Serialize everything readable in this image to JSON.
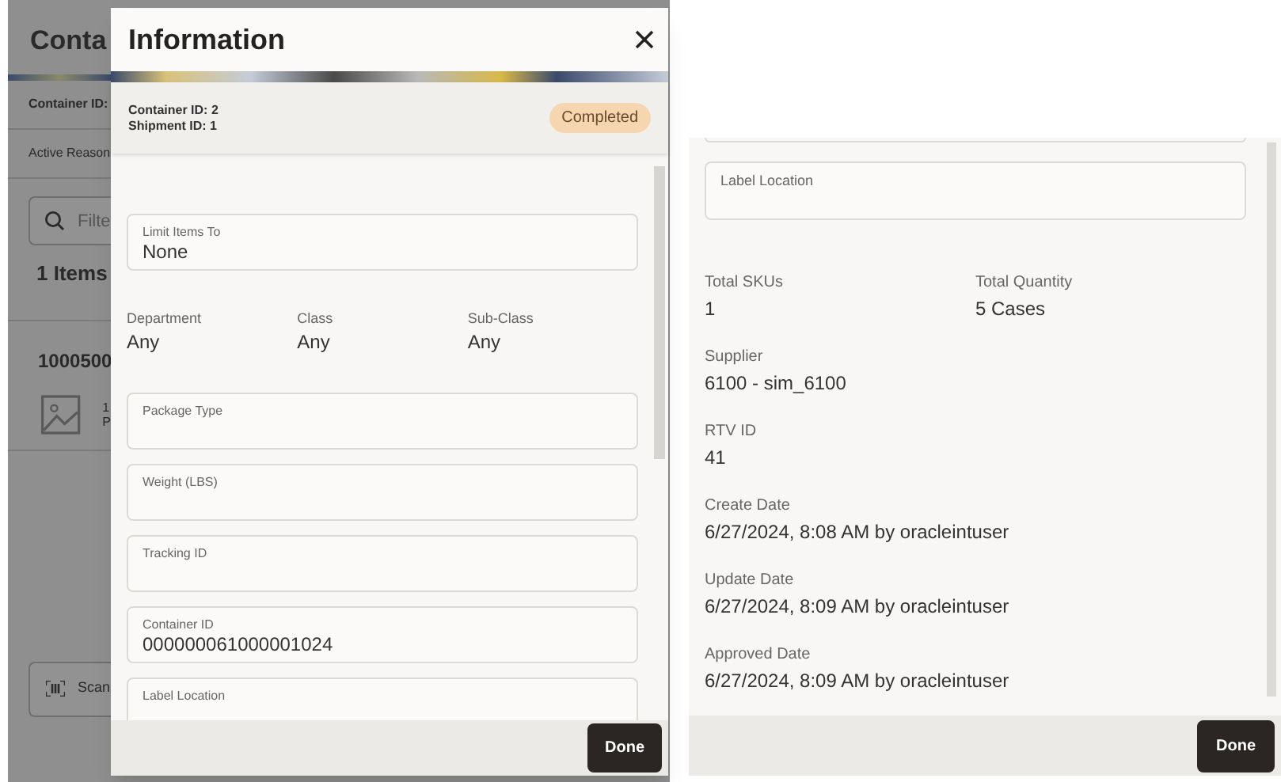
{
  "background_app": {
    "title": "Conta",
    "container_label": "Container ID:",
    "reason_label": "Active Reason",
    "search": {
      "placeholder": "Filte"
    },
    "items_count": "1 Items",
    "item_id": "1000500",
    "item_details": [
      "1",
      "P"
    ],
    "scan_button": "Scan"
  },
  "dialog": {
    "title": "Information",
    "summary": {
      "lines": [
        "Container ID: 2",
        "Shipment ID: 1"
      ],
      "status": "Completed"
    },
    "form": [
      {
        "kind": "field",
        "label": "Limit Items To",
        "value": "None"
      },
      {
        "kind": "info_row",
        "items": [
          {
            "label": "Department",
            "value": "Any"
          },
          {
            "label": "Class",
            "value": "Any"
          },
          {
            "label": "Sub-Class",
            "value": "Any"
          }
        ]
      },
      {
        "kind": "field",
        "label": "Package Type"
      },
      {
        "kind": "field",
        "label": "Weight (LBS)"
      },
      {
        "kind": "field",
        "label": "Tracking ID"
      },
      {
        "kind": "field",
        "label": "Container ID",
        "value": "000000061000001024"
      },
      {
        "kind": "field",
        "label": "Label Location"
      }
    ],
    "done_button": "Done"
  },
  "scrolled_dialog": {
    "form": [
      {
        "kind": "field_edge"
      },
      {
        "kind": "field",
        "label": "Label Location"
      },
      {
        "kind": "info_row",
        "items": [
          {
            "label": "Total SKUs",
            "value": "1"
          },
          {
            "label": "Total Quantity",
            "value": "5 Cases"
          }
        ]
      },
      {
        "kind": "info_row",
        "items": [
          {
            "label": "Supplier",
            "value": "6100 - sim_6100"
          }
        ]
      },
      {
        "kind": "info_row",
        "items": [
          {
            "label": "RTV ID",
            "value": "41"
          }
        ]
      },
      {
        "kind": "info_row",
        "items": [
          {
            "label": "Create Date",
            "value": "6/27/2024, 8:08 AM by oracleintuser"
          }
        ]
      },
      {
        "kind": "info_row",
        "items": [
          {
            "label": "Update Date",
            "value": "6/27/2024, 8:09 AM by oracleintuser"
          }
        ]
      },
      {
        "kind": "info_row",
        "items": [
          {
            "label": "Approved Date",
            "value": "6/27/2024, 8:09 AM by oracleintuser"
          }
        ]
      }
    ],
    "done_button": "Done"
  }
}
